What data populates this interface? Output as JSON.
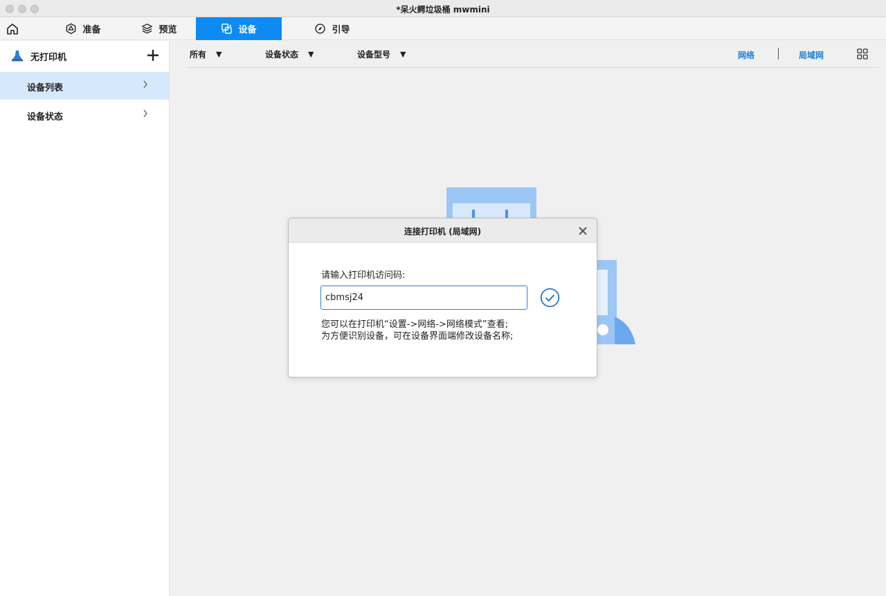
{
  "window": {
    "title": "*呆火鳄垃圾桶 mwmini"
  },
  "nav": {
    "home_icon": "home-icon",
    "tabs": [
      {
        "label": "准备",
        "icon": "hexagon-icon",
        "active": false
      },
      {
        "label": "预览",
        "icon": "layers-icon",
        "active": false
      },
      {
        "label": "设备",
        "icon": "device-icon",
        "active": true
      },
      {
        "label": "引导",
        "icon": "compass-icon",
        "active": false
      }
    ]
  },
  "sidebar": {
    "printer_label": "无打印机",
    "add_icon": "plus-icon",
    "items": [
      {
        "label": "设备列表",
        "active": true
      },
      {
        "label": "设备状态",
        "active": false
      }
    ]
  },
  "filters": {
    "all": "所有",
    "status": "设备状态",
    "model": "设备型号",
    "network": "网络",
    "lan": "局域网",
    "grid_icon": "grid-icon"
  },
  "dialog": {
    "title": "连接打印机 (局域网)",
    "prompt": "请输入打印机访问码:",
    "input_value": "cbmsj24",
    "hint_line1": "您可以在打印机“设置->网络->网络模式”查看;",
    "hint_line2": "为方便识别设备，可在设备界面端修改设备名称;",
    "confirm_icon": "check-circle-icon",
    "close_icon": "close-icon"
  },
  "colors": {
    "accent": "#0d8bf2",
    "link": "#1a7fd6",
    "selected": "#d6e8fb"
  }
}
